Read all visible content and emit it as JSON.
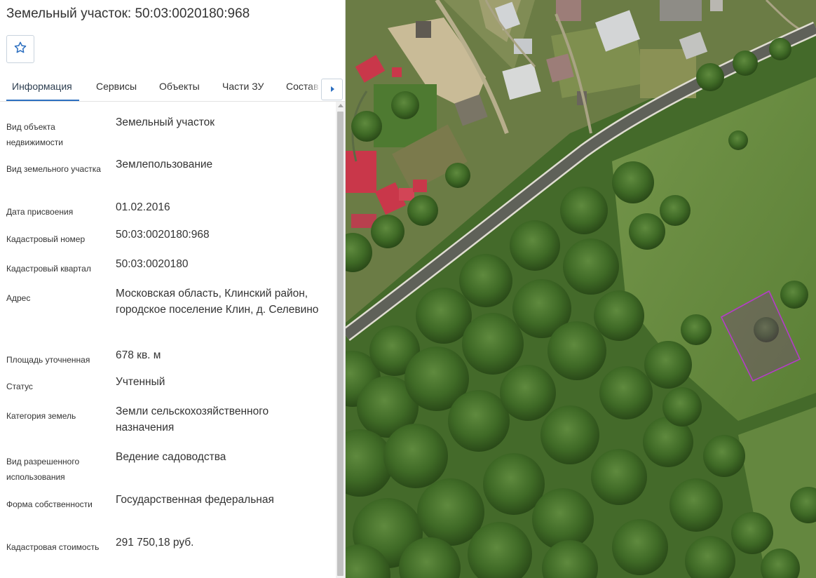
{
  "page": {
    "title": "Земельный участок: 50:03:0020180:968"
  },
  "toolbar": {
    "favorite_icon": "star-outline-icon",
    "accent_color": "#2c6fc0"
  },
  "tabs": [
    {
      "label": "Информация",
      "active": true
    },
    {
      "label": "Сервисы",
      "active": false
    },
    {
      "label": "Объекты",
      "active": false
    },
    {
      "label": "Части ЗУ",
      "active": false
    },
    {
      "label": "Состав",
      "active": false
    }
  ],
  "tabs_scroll_icon": "caret-right-icon",
  "info": [
    {
      "key": "Вид объекта недвижимости",
      "value": "Земельный участок"
    },
    {
      "key": "Вид земельного участка",
      "value": "Землепользование"
    },
    {
      "key": "Дата присвоения",
      "value": "01.02.2016"
    },
    {
      "key": "Кадастровый номер",
      "value": "50:03:0020180:968"
    },
    {
      "key": "Кадастровый квартал",
      "value": "50:03:0020180"
    },
    {
      "key": "Адрес",
      "value": "Московская область, Клинский район, городское поселение Клин, д. Селевино"
    },
    {
      "key": "Площадь уточненная",
      "value": "678 кв. м"
    },
    {
      "key": "Статус",
      "value": "Учтенный"
    },
    {
      "key": "Категория земель",
      "value": "Земли сельскохозяйственного назначения"
    },
    {
      "key": "Вид разрешенного использования",
      "value": "Ведение садоводства"
    },
    {
      "key": "Форма собственности",
      "value": "Государственная федеральная"
    },
    {
      "key": "Кадастровая стоимость",
      "value": "291 750,18 руб."
    }
  ],
  "map": {
    "highlight_color": "#b43cc8"
  }
}
